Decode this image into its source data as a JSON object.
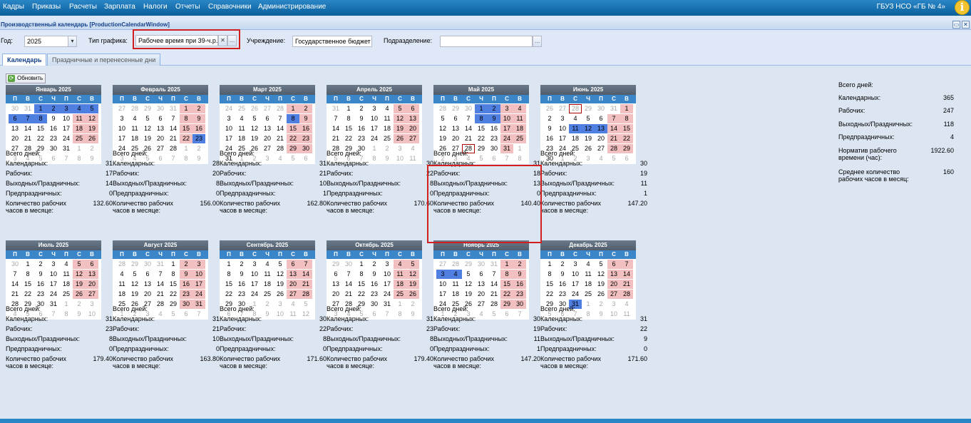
{
  "menu": {
    "items": [
      "Кадры",
      "Приказы",
      "Расчеты",
      "Зарплата",
      "Налоги",
      "Отчеты",
      "Справочники",
      "Администрирование"
    ],
    "org": "ГБУЗ НСО «ГБ № 4»"
  },
  "window": {
    "title": "Производственный календарь [ProductionCalendarWindow]"
  },
  "filters": {
    "year_label": "Год:",
    "year_value": "2025",
    "schedule_label": "Тип графика:",
    "schedule_value": "Рабочее время при 39-ч.р.н.",
    "institution_label": "Учреждение:",
    "institution_value": "Государственное бюджет",
    "division_label": "Подразделение:",
    "division_value": ""
  },
  "tabs": [
    "Календарь",
    "Праздничные и перенесенные дни"
  ],
  "refresh_label": "Обновить",
  "weekdays": [
    "П",
    "В",
    "С",
    "Ч",
    "П",
    "С",
    "В"
  ],
  "stat_labels": {
    "total": "Всего дней:",
    "calendar": "Календарных:",
    "working": "Рабочих:",
    "weekends": "Выходных/Праздничных:",
    "preholiday": "Предпраздничных:",
    "hours": "Количество рабочих часов в месяце:"
  },
  "months": [
    {
      "title": "Январь 2025",
      "calendar": "31",
      "working": "17",
      "weekends": "14",
      "preholiday": "0",
      "hours": "132.60",
      "days": [
        "30o",
        "31o",
        "1h",
        "2h",
        "3h",
        "4h",
        "5h",
        "6h",
        "7h",
        "8h",
        "9",
        "10",
        "11w",
        "12w",
        "13",
        "14",
        "15",
        "16",
        "17",
        "18w",
        "19w",
        "20",
        "21",
        "22",
        "23",
        "24",
        "25w",
        "26w",
        "27",
        "28",
        "29",
        "30",
        "31",
        "1o",
        "2o",
        "3o",
        "4o",
        "5o",
        "6o",
        "7o",
        "8o",
        "9o"
      ]
    },
    {
      "title": "Февраль 2025",
      "calendar": "28",
      "working": "20",
      "weekends": "8",
      "preholiday": "0",
      "hours": "156.00",
      "days": [
        "27o",
        "28o",
        "29o",
        "30o",
        "31o",
        "1w",
        "2w",
        "3",
        "4",
        "5",
        "6",
        "7",
        "8w",
        "9w",
        "10",
        "11",
        "12",
        "13",
        "14",
        "15w",
        "16w",
        "17",
        "18",
        "19",
        "20",
        "21",
        "22w",
        "23h",
        "24",
        "25",
        "26",
        "27",
        "28",
        "1o",
        "2o",
        "3o",
        "4o",
        "5o",
        "6o",
        "7o",
        "8o",
        "9o"
      ]
    },
    {
      "title": "Март 2025",
      "calendar": "31",
      "working": "21",
      "weekends": "10",
      "preholiday": "1",
      "hours": "162.80",
      "days": [
        "24o",
        "25o",
        "26o",
        "27o",
        "28o",
        "1w",
        "2w",
        "3",
        "4",
        "5",
        "6",
        "7",
        "8h",
        "9w",
        "10",
        "11",
        "12",
        "13",
        "14",
        "15w",
        "16w",
        "17",
        "18",
        "19",
        "20",
        "21",
        "22w",
        "23w",
        "24",
        "25",
        "26",
        "27",
        "28",
        "29w",
        "30w",
        "31",
        "1o",
        "2o",
        "3o",
        "4o",
        "5o",
        "6o"
      ]
    },
    {
      "title": "Апрель 2025",
      "calendar": "30",
      "working": "22",
      "weekends": "8",
      "preholiday": "0",
      "hours": "170.60",
      "days": [
        "31o",
        "1",
        "2",
        "3",
        "4",
        "5w",
        "6w",
        "7",
        "8",
        "9",
        "10",
        "11",
        "12w",
        "13w",
        "14",
        "15",
        "16",
        "17",
        "18",
        "19w",
        "20w",
        "21",
        "22",
        "23",
        "24",
        "25",
        "26w",
        "27w",
        "28",
        "29",
        "30",
        "1o",
        "2o",
        "3o",
        "4o",
        "5o",
        "6o",
        "7o",
        "8o",
        "9o",
        "10o",
        "11o"
      ]
    },
    {
      "title": "Май 2025",
      "calendar": "31",
      "working": "18",
      "weekends": "13",
      "preholiday": "0",
      "hours": "140.40",
      "days": [
        "28o",
        "29o",
        "30o",
        "1h",
        "2h",
        "3w",
        "4w",
        "5",
        "6",
        "7",
        "8h",
        "9h",
        "10w",
        "11w",
        "12",
        "13",
        "14",
        "15",
        "16",
        "17w",
        "18w",
        "19",
        "20",
        "21",
        "22",
        "23",
        "24w",
        "25w",
        "26",
        "27",
        "28t",
        "29",
        "30",
        "31w",
        "1o",
        "2o",
        "3o",
        "4o",
        "5o",
        "6o",
        "7o",
        "8o"
      ]
    },
    {
      "title": "Июнь 2025",
      "calendar": "30",
      "working": "19",
      "weekends": "11",
      "preholiday": "1",
      "hours": "147.20",
      "days": [
        "26o",
        "27o",
        "28ot",
        "29o",
        "30o",
        "31o",
        "1w",
        "2",
        "3",
        "4",
        "5",
        "6",
        "7w",
        "8w",
        "9",
        "10",
        "11h",
        "12h",
        "13h",
        "14w",
        "15w",
        "16",
        "17",
        "18",
        "19",
        "20",
        "21w",
        "22w",
        "23",
        "24",
        "25",
        "26",
        "27",
        "28w",
        "29w",
        "30",
        "1o",
        "2o",
        "3o",
        "4o",
        "5o",
        "6o"
      ]
    },
    {
      "title": "Июль 2025",
      "calendar": "31",
      "working": "23",
      "weekends": "8",
      "preholiday": "0",
      "hours": "179.40",
      "days": [
        "30o",
        "1",
        "2",
        "3",
        "4",
        "5w",
        "6w",
        "7",
        "8",
        "9",
        "10",
        "11",
        "12w",
        "13w",
        "14",
        "15",
        "16",
        "17",
        "18",
        "19w",
        "20w",
        "21",
        "22",
        "23",
        "24",
        "25",
        "26w",
        "27w",
        "28",
        "29",
        "30",
        "31",
        "1o",
        "2o",
        "3o",
        "4o",
        "5o",
        "6o",
        "7o",
        "8o",
        "9o",
        "10o"
      ]
    },
    {
      "title": "Август 2025",
      "calendar": "31",
      "working": "21",
      "weekends": "10",
      "preholiday": "0",
      "hours": "163.80",
      "days": [
        "28o",
        "29o",
        "30o",
        "31o",
        "1",
        "2w",
        "3w",
        "4",
        "5",
        "6",
        "7",
        "8",
        "9w",
        "10w",
        "11",
        "12",
        "13",
        "14",
        "15",
        "16w",
        "17w",
        "18",
        "19",
        "20",
        "21",
        "22",
        "23w",
        "24w",
        "25",
        "26",
        "27",
        "28",
        "29",
        "30w",
        "31w",
        "1o",
        "2o",
        "3o",
        "4o",
        "5o",
        "6o",
        "7o"
      ]
    },
    {
      "title": "Сентябрь 2025",
      "calendar": "30",
      "working": "22",
      "weekends": "8",
      "preholiday": "0",
      "hours": "171.60",
      "days": [
        "1",
        "2",
        "3",
        "4",
        "5",
        "6w",
        "7w",
        "8",
        "9",
        "10",
        "11",
        "12",
        "13w",
        "14w",
        "15",
        "16",
        "17",
        "18",
        "19",
        "20w",
        "21w",
        "22",
        "23",
        "24",
        "25",
        "26",
        "27w",
        "28w",
        "29",
        "30",
        "1o",
        "2o",
        "3o",
        "4o",
        "5o",
        "6o",
        "7o",
        "8o",
        "9o",
        "10o",
        "11o",
        "12o"
      ]
    },
    {
      "title": "Октябрь 2025",
      "calendar": "31",
      "working": "23",
      "weekends": "8",
      "preholiday": "0",
      "hours": "179.40",
      "days": [
        "29o",
        "30o",
        "1",
        "2",
        "3",
        "4w",
        "5w",
        "6",
        "7",
        "8",
        "9",
        "10",
        "11w",
        "12w",
        "13",
        "14",
        "15",
        "16",
        "17",
        "18w",
        "19w",
        "20",
        "21",
        "22",
        "23",
        "24",
        "25w",
        "26w",
        "27",
        "28",
        "29",
        "30",
        "31",
        "1o",
        "2o",
        "3o",
        "4o",
        "5o",
        "6o",
        "7o",
        "8o",
        "9o"
      ]
    },
    {
      "title": "Ноябрь 2025",
      "calendar": "30",
      "working": "19",
      "weekends": "11",
      "preholiday": "1",
      "hours": "147.20",
      "days": [
        "27o",
        "28o",
        "29o",
        "30o",
        "31o",
        "1w",
        "2w",
        "3h",
        "4h",
        "5",
        "6",
        "7",
        "8w",
        "9w",
        "10",
        "11",
        "12",
        "13",
        "14",
        "15w",
        "16w",
        "17",
        "18",
        "19",
        "20",
        "21",
        "22w",
        "23w",
        "24",
        "25",
        "26",
        "27",
        "28",
        "29w",
        "30w",
        "1o",
        "2o",
        "3o",
        "4o",
        "5o",
        "6o",
        "7o"
      ]
    },
    {
      "title": "Декабрь 2025",
      "calendar": "31",
      "working": "22",
      "weekends": "9",
      "preholiday": "0",
      "hours": "171.60",
      "days": [
        "1",
        "2",
        "3",
        "4",
        "5",
        "6w",
        "7w",
        "8",
        "9",
        "10",
        "11",
        "12",
        "13w",
        "14w",
        "15",
        "16",
        "17",
        "18",
        "19",
        "20w",
        "21w",
        "22",
        "23",
        "24",
        "25",
        "26",
        "27w",
        "28w",
        "29",
        "30",
        "31h",
        "1o",
        "2o",
        "3o",
        "4o",
        "5o",
        "6o",
        "7o",
        "8o",
        "9o",
        "10o",
        "11o"
      ]
    }
  ],
  "summary": {
    "total": "Всего дней:",
    "calendar_label": "Календарных:",
    "calendar": "365",
    "working_label": "Рабочих:",
    "working": "247",
    "weekends_label": "Выходных/Праздничных:",
    "weekends": "118",
    "preholiday_label": "Предпраздничных:",
    "preholiday": "4",
    "norm_label": "Норматив рабочего времени (час):",
    "norm": "1922.60",
    "avg_label": "Среднее количество рабочих часов в месяц:",
    "avg": "160"
  },
  "colors": {
    "menu": "#1a73b5",
    "weekend": "#f2c0c0",
    "holiday": "#4f7fe0",
    "header": "#3a86c8",
    "highlight": "#d21f1f"
  }
}
